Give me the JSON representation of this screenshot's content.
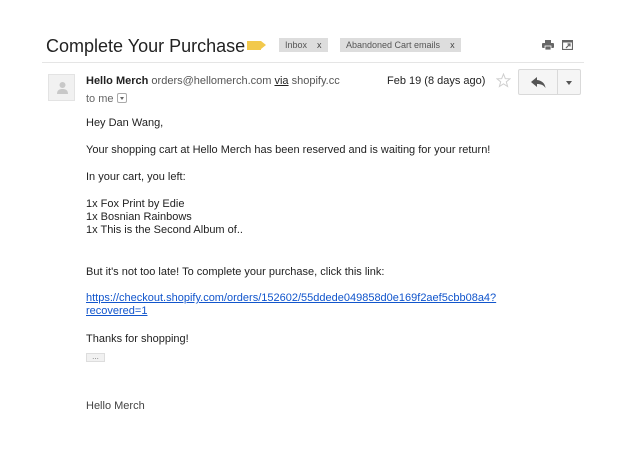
{
  "thread": {
    "subject": "Complete Your Purchase",
    "labels": [
      {
        "name": "Inbox",
        "remove": "x"
      },
      {
        "name": "Abandoned Cart emails",
        "remove": "x"
      }
    ],
    "important_color": "#f2c94c"
  },
  "toolbar": {
    "print_icon": "print-icon",
    "new_window_icon": "new-window-icon"
  },
  "message": {
    "sender_name": "Hello Merch",
    "sender_email": "orders@hellomerch.com",
    "via_label": "via",
    "via_domain": "shopify.cc",
    "date": "Feb 19 (8 days ago)",
    "to_label": "to me",
    "actions": {
      "star_icon": "star-icon",
      "reply_icon": "reply-icon",
      "more_icon": "chevron-down-icon"
    }
  },
  "body": {
    "greeting": "Hey Dan Wang,",
    "paragraph1": "Your shopping cart at Hello Merch has been reserved and is waiting for your return!",
    "paragraph2": "In your cart, you left:",
    "items": [
      "1x Fox Print by Edie",
      "1x Bosnian Rainbows",
      "1x This is the Second Album of.."
    ],
    "paragraph3": "But it's not too late! To complete your purchase, click this link:",
    "link_line1": "https://checkout.shopify.com/orders/152602/55ddede049858d0e169f2aef5cbb08a4?",
    "link_line2": "recovered=1",
    "thanks": "Thanks for shopping!",
    "trimmed_content": "...",
    "signature": "Hello Merch"
  },
  "colors": {
    "link": "#1155cc",
    "label_bg": "#dddddd"
  }
}
